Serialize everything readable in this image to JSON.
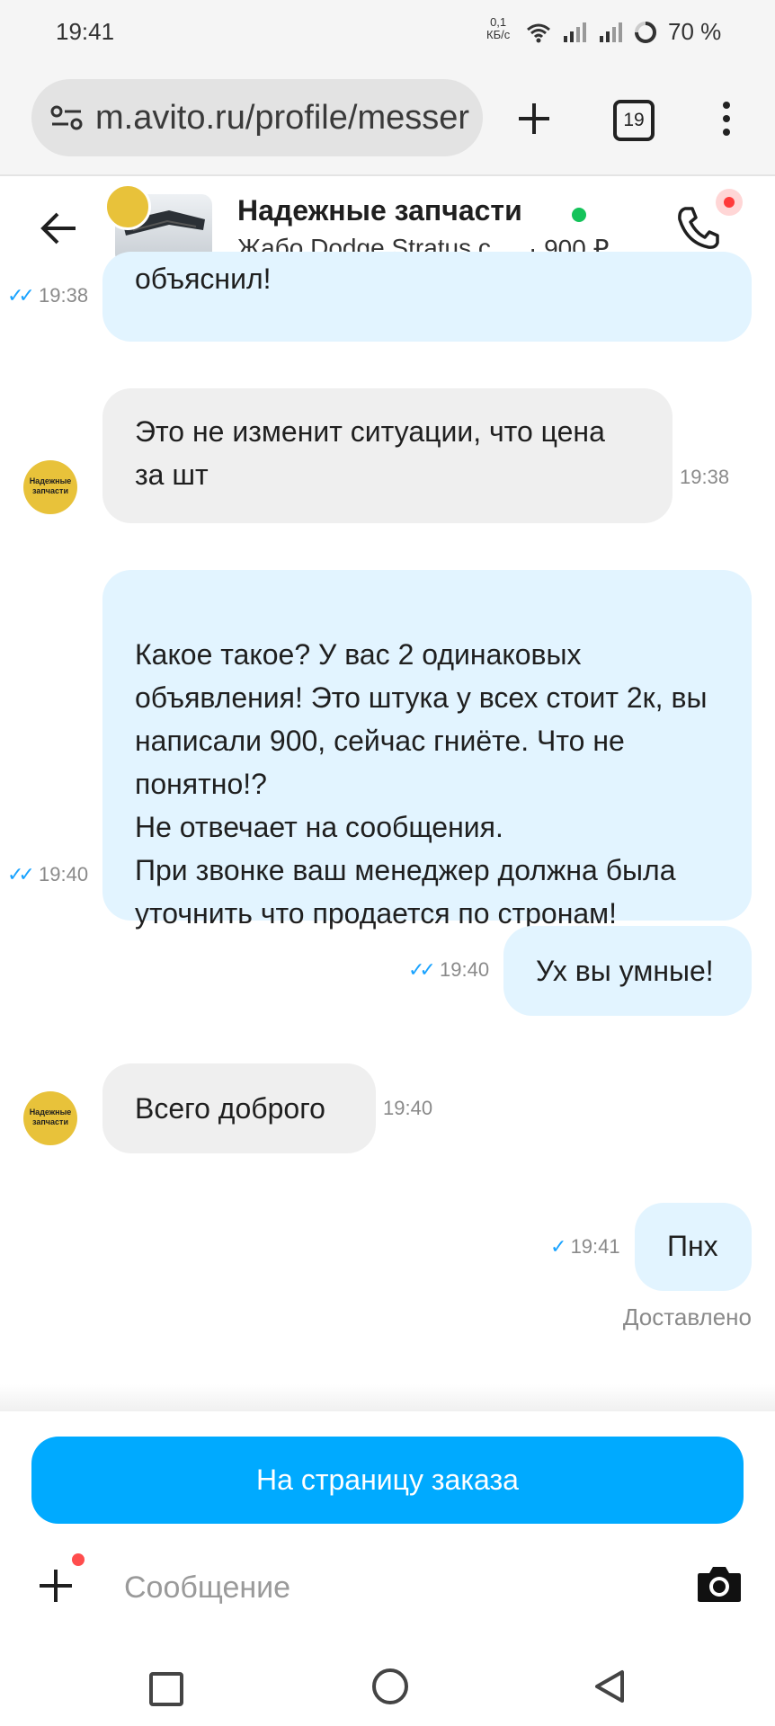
{
  "status_bar": {
    "time": "19:41",
    "net_speed_value": "0,1",
    "net_speed_unit": "КБ/с",
    "battery": "70 %",
    "icons": [
      "wifi-icon",
      "signal-icon",
      "signal-icon",
      "battery-ring-icon"
    ]
  },
  "browser": {
    "url": "m.avito.ru/profile/messer",
    "tab_count": "19",
    "icons": [
      "site-settings-icon",
      "new-tab-icon",
      "tabs-icon",
      "more-vert-icon"
    ]
  },
  "chat_header": {
    "seller_name": "Надежные запчасти",
    "listing_title": "Жабо Dodge Stratus с...",
    "listing_price": "· 900 ₽",
    "avatar_text": "Надежные запчасти",
    "online_color": "#14C35A"
  },
  "messages": [
    {
      "direction": "out",
      "text": "объяснил!",
      "time": "19:38",
      "status": "read"
    },
    {
      "direction": "in",
      "text": "Это не изменит ситуации, что цена за шт",
      "time": "19:38"
    },
    {
      "direction": "out",
      "text": "Какое такое? У вас 2 одинаковых объявления! Это штука у всех стоит 2к, вы написали 900, сейчас гниёте. Что не понятно!?\nНе отвечает на сообщения.\nПри звонке ваш менеджер должна была уточнить что продается по стронам!",
      "time": "19:40",
      "status": "read"
    },
    {
      "direction": "out",
      "text": "Ух вы умные!",
      "time": "19:40",
      "status": "read"
    },
    {
      "direction": "in",
      "text": "Всего доброго",
      "time": "19:40"
    },
    {
      "direction": "out",
      "text": "Пнх",
      "time": "19:41",
      "status": "sent"
    }
  ],
  "delivered_label": "Доставлено",
  "order_button": "На страницу заказа",
  "composer": {
    "placeholder": "Сообщение",
    "icons": [
      "plus-icon",
      "camera-icon"
    ]
  },
  "colors": {
    "accent": "#00AAFF",
    "outgoing_bubble": "#E2F4FF",
    "incoming_bubble": "#EFEFEF",
    "check": "#1AA3FF",
    "avatar": "#E8C23A"
  },
  "nav_bar": {
    "icons": [
      "recents-square-icon",
      "home-circle-icon",
      "back-triangle-icon"
    ]
  }
}
